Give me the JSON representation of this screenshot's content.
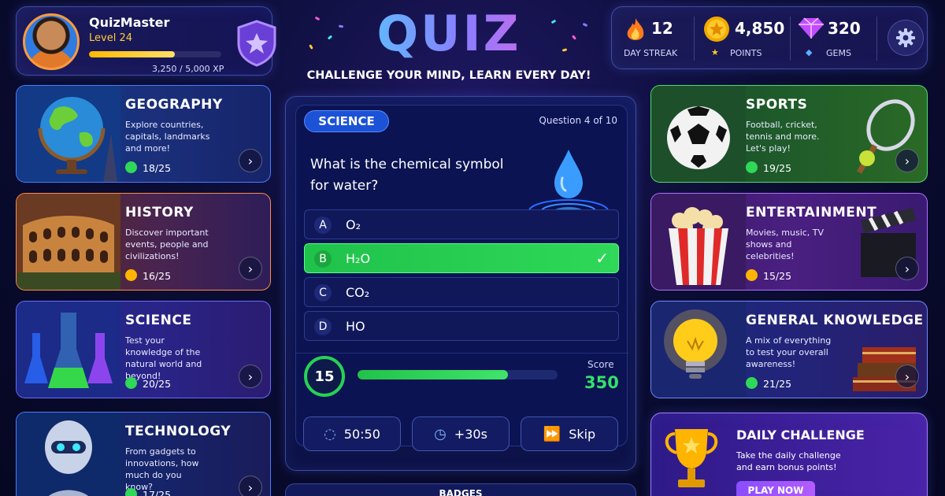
{
  "profile": {
    "name": "QuizMaster",
    "level": "Level 24",
    "xp_text": "3,250 / 5,000 XP",
    "xp_progress": 0.65
  },
  "header": {
    "title": "QUIZ",
    "tagline": "CHALLENGE YOUR MIND, LEARN EVERY DAY!"
  },
  "stats": {
    "streak": {
      "value": "12",
      "label": "DAY STREAK"
    },
    "points": {
      "value": "4,850",
      "label": "POINTS"
    },
    "gems": {
      "value": "320",
      "label": "GEMS"
    }
  },
  "categories_left": [
    {
      "title": "GEOGRAPHY",
      "desc": "Explore countries, capitals, landmarks and more!",
      "progress": "18/25"
    },
    {
      "title": "HISTORY",
      "desc": "Discover important events, people and civilizations!",
      "progress": "16/25"
    },
    {
      "title": "SCIENCE",
      "desc": "Test your knowledge of the natural world and beyond!",
      "progress": "20/25"
    },
    {
      "title": "TECHNOLOGY",
      "desc": "From gadgets to innovations, how much do you know?",
      "progress": "17/25"
    }
  ],
  "categories_right": [
    {
      "title": "SPORTS",
      "desc": "Football, cricket, tennis and more. Let's play!",
      "progress": "19/25"
    },
    {
      "title": "ENTERTAINMENT",
      "desc": "Movies, music, TV shows and celebrities!",
      "progress": "15/25"
    },
    {
      "title": "GENERAL KNOWLEDGE",
      "desc": "A mix of everything to test your overall awareness!",
      "progress": "21/25"
    }
  ],
  "question": {
    "category": "SCIENCE",
    "counter": "Question 4 of 10",
    "text": "What is the chemical symbol for water?",
    "answers": [
      {
        "letter": "A",
        "text": "O₂"
      },
      {
        "letter": "B",
        "text": "H₂O"
      },
      {
        "letter": "C",
        "text": "CO₂"
      },
      {
        "letter": "D",
        "text": "HO"
      }
    ],
    "correct_index": 1,
    "timer": "15",
    "time_progress": 0.75,
    "score_label": "Score",
    "score": "350"
  },
  "powerups": {
    "fifty": "50:50",
    "time": "+30s",
    "skip": "Skip"
  },
  "badges_label": "BADGES",
  "daily": {
    "title": "DAILY CHALLENGE",
    "desc": "Take the daily challenge and earn bonus points!",
    "button": "PLAY NOW"
  },
  "colors": {
    "accent_green": "#2fd858",
    "accent_gold": "#ffcc33",
    "accent_blue": "#1b52d6"
  }
}
